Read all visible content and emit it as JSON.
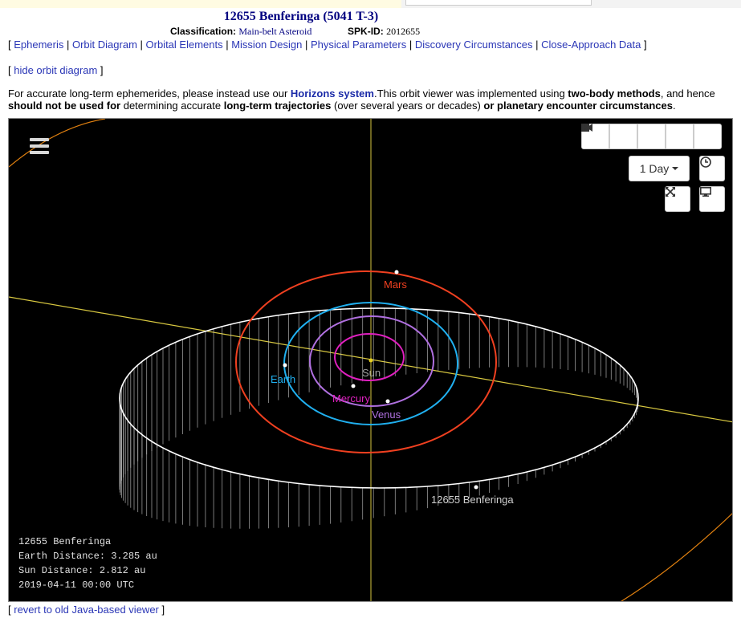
{
  "header": {
    "title": "12655 Benferinga (5041 T-3)",
    "classification_label": "Classification:",
    "classification_value": "Main-belt Asteroid",
    "spkid_label": "SPK-ID:",
    "spkid_value": "2012655"
  },
  "nav": {
    "items": [
      "Ephemeris",
      "Orbit Diagram",
      "Orbital Elements",
      "Mission Design",
      "Physical Parameters",
      "Discovery Circumstances",
      "Close-Approach Data"
    ]
  },
  "hide_link": "hide orbit diagram",
  "notice": {
    "t1": "For accurate long-term ephemerides, please instead use our ",
    "link": "Horizons system",
    "t2": ".This orbit viewer was implemented using ",
    "b1": "two-body methods",
    "t3": ", and hence ",
    "b2": "should not be used for",
    "t4": " determining accurate ",
    "b3": "long-term trajectories",
    "t5": " (over several years or decades) ",
    "b4": "or planetary encounter circumstances",
    "t6": "."
  },
  "viewer": {
    "menu_icon": "hamburger-menu-icon",
    "controls": [
      "fast-backward-icon",
      "step-backward-icon",
      "stop-icon",
      "step-forward-icon",
      "fast-forward-icon"
    ],
    "step_select": "1 Day",
    "labels": {
      "sun": "Sun",
      "mercury": "Mercury",
      "venus": "Venus",
      "earth": "Earth",
      "mars": "Mars",
      "asteroid": "12655 Benferinga"
    },
    "colors": {
      "mercury": "#e020c0",
      "venus": "#b070e0",
      "earth": "#20b0f0",
      "mars": "#f04020",
      "jupiter": "#e08010",
      "axis": "#d8c840"
    },
    "info": {
      "name": "12655 Benferinga",
      "earth_distance": "Earth Distance: 3.285 au",
      "sun_distance": "Sun Distance: 2.812 au",
      "datetime": "2019-04-11 00:00 UTC"
    }
  },
  "revert_link": "revert to old Java-based viewer"
}
